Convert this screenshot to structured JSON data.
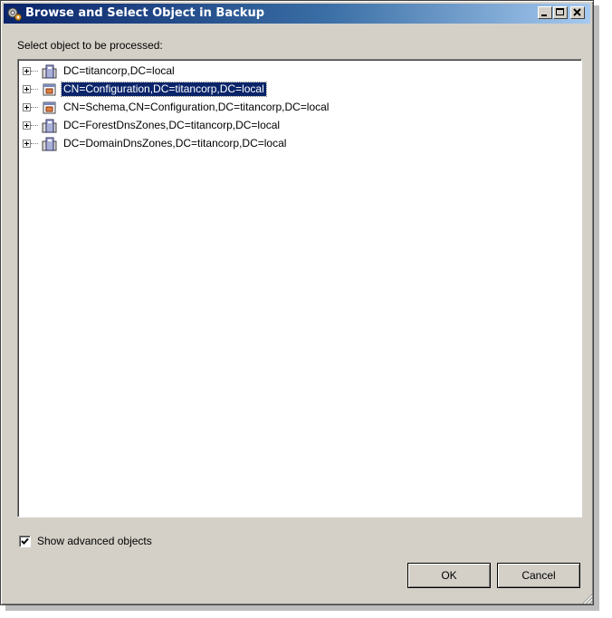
{
  "window": {
    "title": "Browse and Select Object in Backup"
  },
  "prompt_label": "Select object to be processed:",
  "tree": {
    "items": [
      {
        "label": "DC=titancorp,DC=local",
        "icon": "domain-icon",
        "selected": false
      },
      {
        "label": "CN=Configuration,DC=titancorp,DC=local",
        "icon": "container-icon",
        "selected": true
      },
      {
        "label": "CN=Schema,CN=Configuration,DC=titancorp,DC=local",
        "icon": "container-icon",
        "selected": false
      },
      {
        "label": "DC=ForestDnsZones,DC=titancorp,DC=local",
        "icon": "domain-icon",
        "selected": false
      },
      {
        "label": "DC=DomainDnsZones,DC=titancorp,DC=local",
        "icon": "domain-icon",
        "selected": false
      }
    ]
  },
  "show_advanced": {
    "label": "Show advanced objects",
    "checked": true
  },
  "buttons": {
    "ok": "OK",
    "cancel": "Cancel"
  },
  "colors": {
    "title_bar": "#0a246a",
    "selection": "#0a246a",
    "dialog_bg": "#d4d0c8"
  }
}
